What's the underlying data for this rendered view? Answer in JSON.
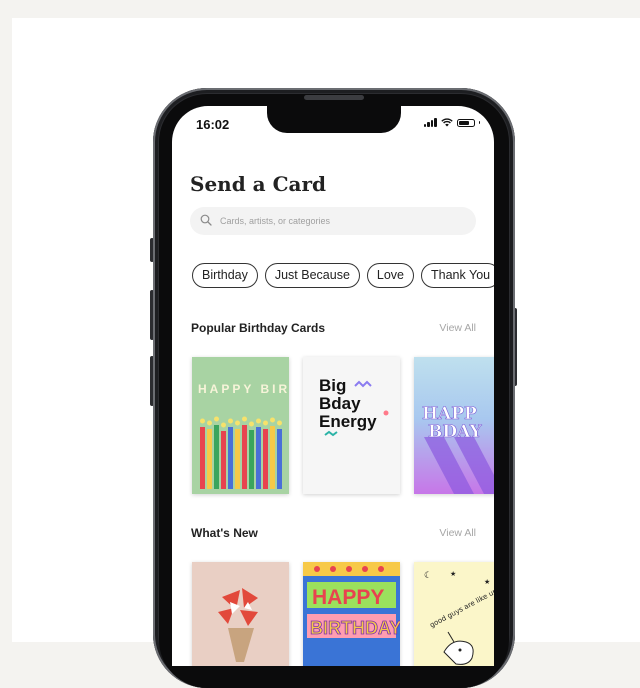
{
  "status_bar": {
    "time": "16:02"
  },
  "screen_title": "Send a Card",
  "search": {
    "placeholder": "Cards, artists, or categories"
  },
  "chips": [
    "Birthday",
    "Just Because",
    "Love",
    "Thank You"
  ],
  "sections": [
    {
      "title": "Popular Birthday Cards",
      "view_all": "View All",
      "cards": [
        {
          "art_text": "HAPPY BIRTHDAY"
        },
        {
          "art_text": [
            "Big",
            "Bday",
            "Energy"
          ]
        },
        {
          "art_text": [
            "HAPP",
            "BDAY"
          ]
        }
      ]
    },
    {
      "title": "What's New",
      "view_all": "View All",
      "cards": [
        {
          "art_text": ""
        },
        {
          "art_text": [
            "HAPPY",
            "BIRTHDAY"
          ]
        },
        {
          "art_text": "good guys are like unicorns"
        }
      ]
    }
  ]
}
